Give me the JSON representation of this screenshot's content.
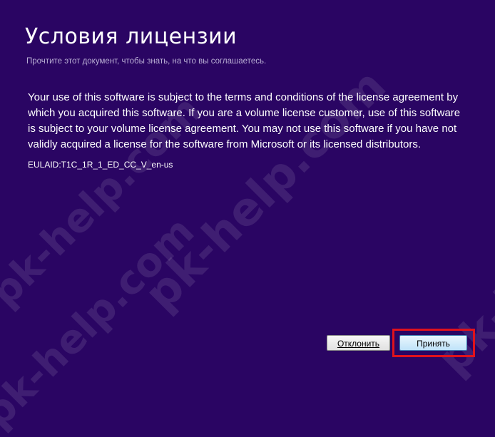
{
  "header": {
    "title": "Условия лицензии",
    "subtitle": "Прочтите этот документ, чтобы знать, на что вы соглашаетесь."
  },
  "license": {
    "text": "Your use of this software is subject to the terms and conditions of the license agreement by which you acquired this software.  If you are a volume license customer, use of this software is subject to your volume license agreement.  You may not use this software if you have not validly acquired a license for the software from Microsoft or its licensed distributors.",
    "eula_id": "EULAID:T1C_1R_1_ED_CC_V_en-us"
  },
  "buttons": {
    "decline_label": "Отклонить",
    "accept_label": "Принять"
  },
  "watermark": {
    "text": "pk-help.com"
  },
  "colors": {
    "background": "#2a0563",
    "highlight": "#e0121c"
  }
}
